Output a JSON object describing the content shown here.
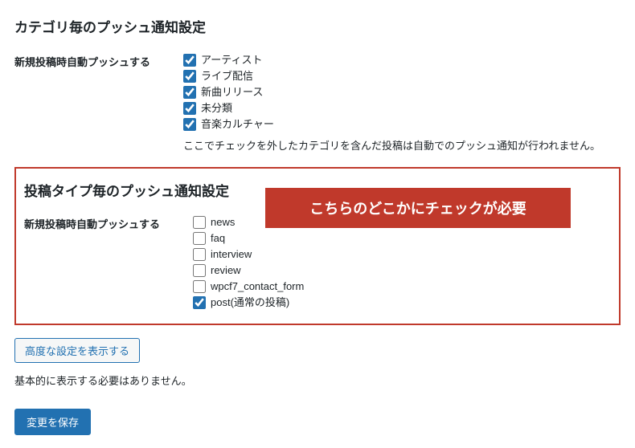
{
  "categorySection": {
    "title": "カテゴリ毎のプッシュ通知設定",
    "label": "新規投稿時自動プッシュする",
    "items": [
      {
        "label": "アーティスト",
        "checked": true
      },
      {
        "label": "ライブ配信",
        "checked": true
      },
      {
        "label": "新曲リリース",
        "checked": true
      },
      {
        "label": "未分類",
        "checked": true
      },
      {
        "label": "音楽カルチャー",
        "checked": true
      }
    ],
    "help": "ここでチェックを外したカテゴリを含んだ投稿は自動でのプッシュ通知が行われません。"
  },
  "postTypeSection": {
    "title": "投稿タイプ毎のプッシュ通知設定",
    "label": "新規投稿時自動プッシュする",
    "callout": "こちらのどこかにチェックが必要",
    "items": [
      {
        "label": "news",
        "checked": false
      },
      {
        "label": "faq",
        "checked": false
      },
      {
        "label": "interview",
        "checked": false
      },
      {
        "label": "review",
        "checked": false
      },
      {
        "label": "wpcf7_contact_form",
        "checked": false
      },
      {
        "label": "post(通常の投稿)",
        "checked": true
      }
    ]
  },
  "advancedButton": "高度な設定を表示する",
  "advancedNote": "基本的に表示する必要はありません。",
  "saveButton": "変更を保存"
}
